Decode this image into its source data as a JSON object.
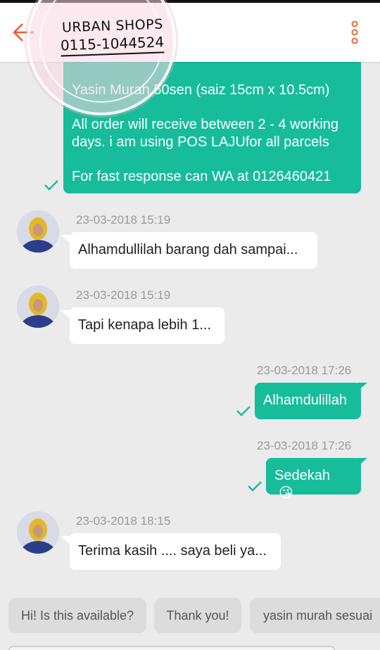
{
  "header": {
    "stamp_line1": "URBAN SHOPS",
    "stamp_line2": "0115-1044524"
  },
  "colors": {
    "accent": "#ef5a2a",
    "bubble_out": "#17bc9b",
    "bubble_in": "#ffffff",
    "background": "#ebebeb"
  },
  "first_message": {
    "lines": [
      "Yasin Murah 50sen (saiz 15cm x 10.5cm)",
      "All order will receive between 2 - 4 working days. i am using POS LAJUfor all parcels",
      "For fast response can WA at 0126460421"
    ]
  },
  "messages": [
    {
      "timestamp": "23-03-2018 15:19",
      "text": "Alhamdullilah barang dah sampai..."
    },
    {
      "timestamp": "23-03-2018 15:19",
      "text": "Tapi kenapa lebih 1..."
    },
    {
      "timestamp": "23-03-2018 17:26",
      "text": "Alhamdulillah"
    },
    {
      "timestamp": "23-03-2018 17:26",
      "text": "Sedekah",
      "emoji": "😘"
    },
    {
      "timestamp": "23-03-2018 18:15",
      "text": "Terima kasih .... saya beli ya..."
    }
  ],
  "quick_replies": [
    "Hi! Is this available?",
    "Thank you!",
    "yasin murah sesuai"
  ]
}
